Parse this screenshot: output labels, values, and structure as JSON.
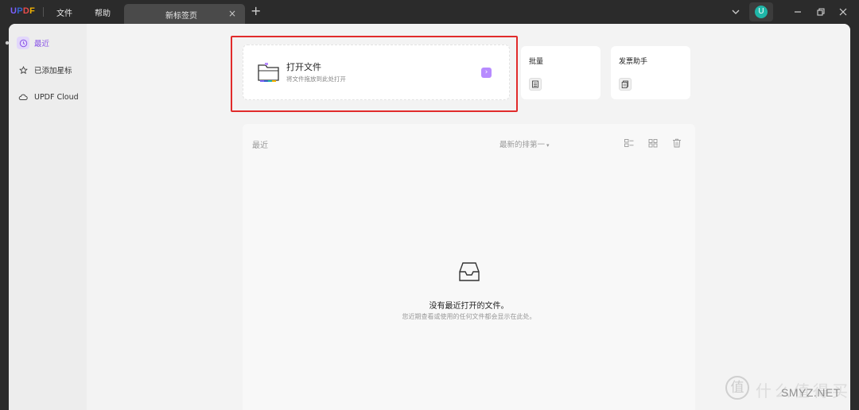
{
  "titlebar": {
    "logo": {
      "u": "U",
      "p": "P",
      "d": "D",
      "f": "F"
    },
    "menu_file": "文件",
    "menu_help": "帮助",
    "tab_label": "新标签页",
    "tab_close": "×",
    "tab_add": "+",
    "avatar_letter": "U"
  },
  "sidebar": {
    "items": [
      {
        "label": "最近",
        "icon": "clock-icon",
        "active": true
      },
      {
        "label": "已添加星标",
        "icon": "star-icon",
        "active": false
      },
      {
        "label": "UPDF Cloud",
        "icon": "cloud-icon",
        "active": false
      }
    ]
  },
  "open_card": {
    "title": "打开文件",
    "subtitle": "将文件拖放到此处打开",
    "arrow": "›"
  },
  "tools": [
    {
      "title": "批量",
      "icon": "batch-icon"
    },
    {
      "title": "发票助手",
      "icon": "invoice-icon"
    }
  ],
  "recent": {
    "title": "最近",
    "sort_label": "最新的排第一",
    "sort_caret": "▾",
    "empty_title": "没有最近打开的文件。",
    "empty_subtitle": "您近期查看或使用的任何文件都会显示在此处。"
  },
  "watermark": {
    "circle": "值",
    "text": "什么值得买",
    "sub": "SMYZ.NET"
  },
  "colors": {
    "accent": "#8a55e6",
    "highlight_border": "#e12b2b",
    "titlebar": "#2b2b2b"
  }
}
